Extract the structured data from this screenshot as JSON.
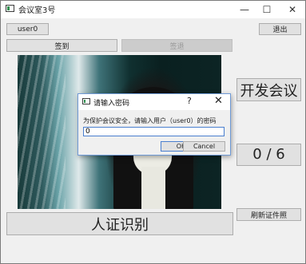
{
  "window": {
    "title": "会议室3号"
  },
  "window_controls": {
    "minimize": "—",
    "maximize": "☐",
    "close": "✕"
  },
  "user_button": {
    "label": "user0"
  },
  "logout_button": {
    "label": "退出"
  },
  "checkin_button": {
    "label": "签到"
  },
  "checkout_button": {
    "label": "签退"
  },
  "start_meeting_button": {
    "label": "开发会议"
  },
  "attendance": {
    "text": "0 / 6"
  },
  "refresh_id_button": {
    "label": "刷新证件照"
  },
  "face_id_button": {
    "label": "人证识别"
  },
  "password_dialog": {
    "title": "请输入密码",
    "help": "?",
    "close": "✕",
    "prompt": "为保护会议安全，请输入用户（user0）的密码",
    "input_value": "0",
    "ok_label": "OK",
    "cancel_label": "Cancel"
  }
}
